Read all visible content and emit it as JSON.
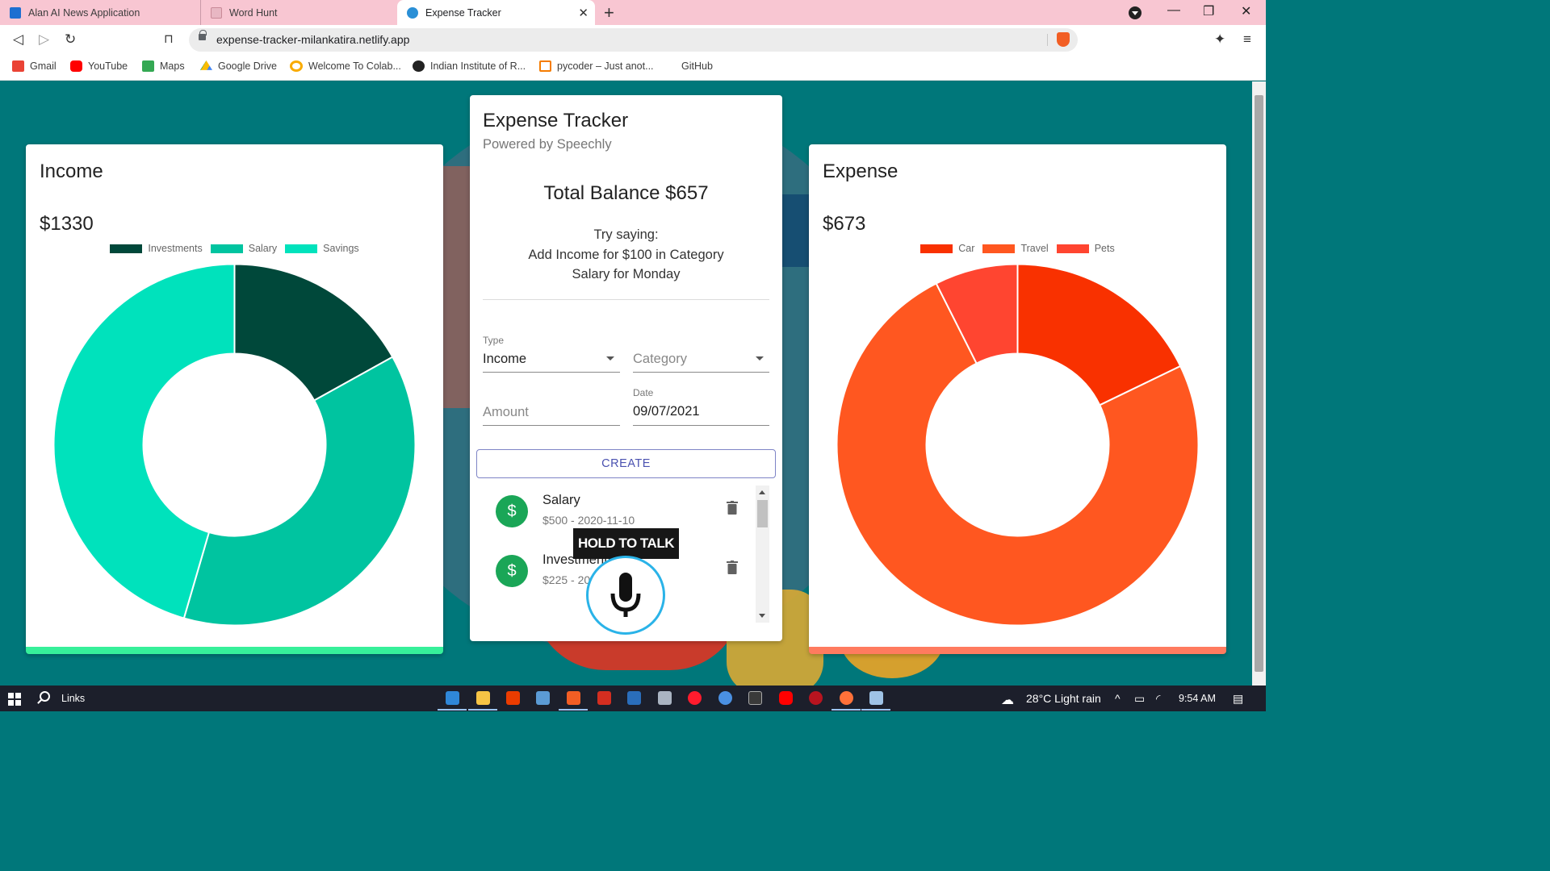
{
  "browser": {
    "tabs": [
      {
        "title": "Alan AI News Application",
        "favicon_color": "#1d6fd1"
      },
      {
        "title": "Word Hunt",
        "favicon_color": "#c98a98"
      },
      {
        "title": "Expense Tracker",
        "favicon_color": "#2a8fd6",
        "active": true
      }
    ],
    "url": "expense-tracker-milankatira.netlify.app",
    "bookmarks": [
      {
        "label": "Gmail",
        "color": "#ea4335"
      },
      {
        "label": "YouTube",
        "color": "#ff0000"
      },
      {
        "label": "Maps",
        "color": "#34a853"
      },
      {
        "label": "Google Drive",
        "color": "#fbbc04"
      },
      {
        "label": "Welcome To Colab...",
        "color": "#f9ab00"
      },
      {
        "label": "Indian Institute of R...",
        "color": "#222222"
      },
      {
        "label": "pycoder – Just anot...",
        "color": "#f57c00"
      },
      {
        "label": "GitHub",
        "color": "#ffffff"
      }
    ]
  },
  "income": {
    "title": "Income",
    "amount": "$1330",
    "accent": "#36f09a",
    "legend": [
      {
        "label": "Investments",
        "color": "#00483a"
      },
      {
        "label": "Salary",
        "color": "#00c4a0"
      },
      {
        "label": "Savings",
        "color": "#00e2bc"
      }
    ],
    "chart_data": {
      "type": "pie",
      "categories": [
        "Investments",
        "Salary",
        "Savings"
      ],
      "values": [
        225,
        500,
        605
      ],
      "colors": [
        "#00483a",
        "#00c4a0",
        "#00e2bc"
      ],
      "title": "Income"
    }
  },
  "expense": {
    "title": "Expense",
    "amount": "$673",
    "accent": "#ff7b5f",
    "legend": [
      {
        "label": "Car",
        "color": "#f93100"
      },
      {
        "label": "Travel",
        "color": "#ff5720"
      },
      {
        "label": "Pets",
        "color": "#ff4530"
      }
    ],
    "chart_data": {
      "type": "pie",
      "categories": [
        "Car",
        "Travel",
        "Pets"
      ],
      "values": [
        120,
        503,
        50
      ],
      "colors": [
        "#f93100",
        "#ff5720",
        "#ff4530"
      ],
      "title": "Expense"
    }
  },
  "tracker": {
    "title": "Expense Tracker",
    "subtitle": "Powered by Speechly",
    "balance": "Total Balance $657",
    "hint_lines": [
      "Try saying:",
      "Add Income for $100 in Category",
      "Salary for Monday"
    ],
    "form": {
      "type_label": "Type",
      "type_value": "Income",
      "category_placeholder": "Category",
      "amount_placeholder": "Amount",
      "date_label": "Date",
      "date_value": "09/07/2021",
      "create_label": "CREATE"
    },
    "transactions": [
      {
        "title": "Salary",
        "subtitle": "$500 - 2020-11-10"
      },
      {
        "title": "Investments",
        "subtitle": "$225 - 2020-11-10"
      }
    ],
    "hold_to_talk": "HOLD TO TALK"
  },
  "taskbar": {
    "search_label": "Links",
    "weather": "28°C  Light rain",
    "time": "9:54 AM"
  }
}
